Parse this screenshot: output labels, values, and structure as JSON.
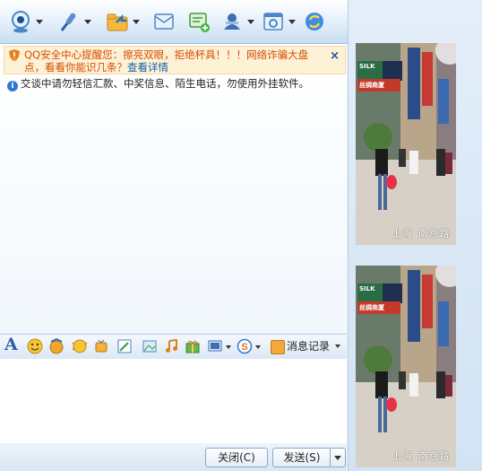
{
  "notice": {
    "line1": "QQ安全中心提醒您：擦亮双眼，拒绝杯具！！！网络诈骗大盘",
    "line2": "点，看看你能识几条？",
    "link": "查看详情",
    "close": "×"
  },
  "info": {
    "text": "交谈中请勿轻信汇款、中奖信息、陌生电话，勿使用外挂软件。"
  },
  "format_bar": {
    "font_label": "A",
    "history_label": "消息记录"
  },
  "buttons": {
    "close_label": "关闭(C)",
    "send_label": "发送(S)"
  },
  "photos": {
    "caption": "上海 南京路",
    "signs": [
      "SILK",
      "丝绸商厦",
      "丝绸商厦"
    ]
  },
  "colors": {
    "notice_text": "#d64c00",
    "link": "#0b5fb0",
    "accent": "#2f7ad0"
  }
}
